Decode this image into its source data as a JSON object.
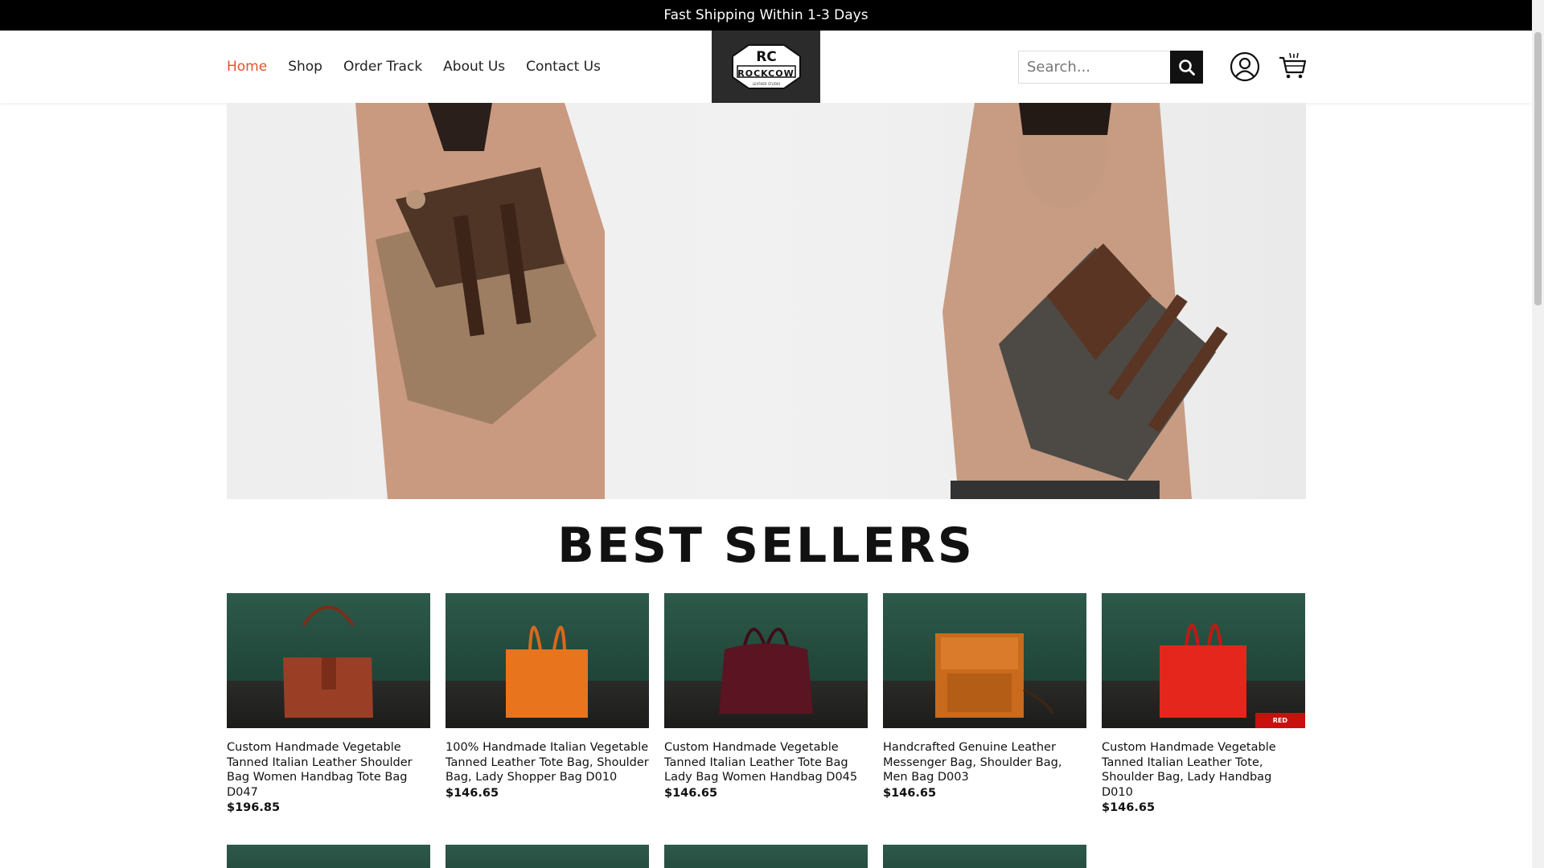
{
  "announcement": "Fast Shipping Within 1-3 Days",
  "nav": {
    "items": [
      {
        "label": "Home",
        "active": true
      },
      {
        "label": "Shop"
      },
      {
        "label": "Order Track"
      },
      {
        "label": "About Us"
      },
      {
        "label": "Contact Us"
      }
    ]
  },
  "logo": {
    "text": "ROCKCOW"
  },
  "search": {
    "placeholder": "Search..."
  },
  "colors": {
    "accent": "#e2542b",
    "topbar": "#000000",
    "sale_badge": "#c8100f"
  },
  "icons": {
    "search": "search-icon",
    "account": "user-icon",
    "cart": "cart-icon"
  },
  "section": {
    "title": "BEST SELLERS"
  },
  "products": [
    {
      "name": "Custom Handmade Vegetable Tanned Italian Leather Shoulder Bag Women Handbag Tote Bag D047",
      "price": "$196.85",
      "color": "#9a3f26"
    },
    {
      "name": "100% Handmade Italian Vegetable Tanned Leather Tote Bag, Shoulder Bag, Lady Shopper Bag D010",
      "price": "$146.65",
      "color": "#e8741e"
    },
    {
      "name": "Custom Handmade Vegetable Tanned Italian Leather Tote Bag Lady Bag Women Handbag D045",
      "price": "$146.65",
      "color": "#5a1422"
    },
    {
      "name": "Handcrafted Genuine Leather Messenger Bag, Shoulder Bag, Men Bag D003",
      "price": "$146.65",
      "color": "#c96a1c"
    },
    {
      "name": "Custom Handmade Vegetable Tanned Italian Leather Tote, Shoulder Bag, Lady Handbag D010",
      "price": "$146.65",
      "color": "#e4261c",
      "badge": "RED"
    }
  ]
}
